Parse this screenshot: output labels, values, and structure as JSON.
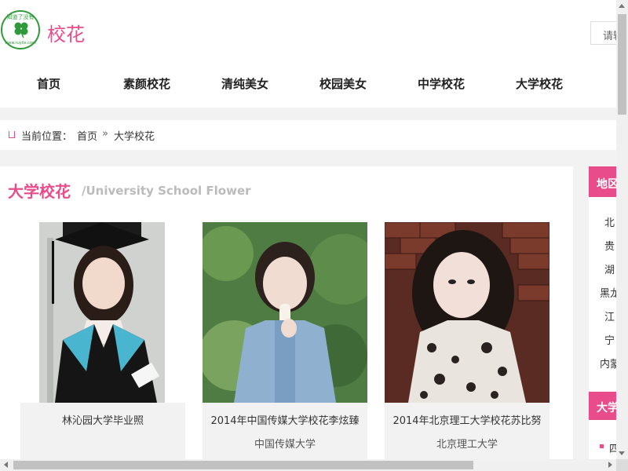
{
  "site": {
    "logo_text": "知道了没有",
    "logo_url": "www.ruyile.com",
    "title": "校花",
    "search_placeholder": "请输入"
  },
  "nav": [
    "首页",
    "素颜校花",
    "清纯美女",
    "校园美女",
    "中学校花",
    "大学校花"
  ],
  "breadcrumb": {
    "label": "当前位置：",
    "home": "首页",
    "separator": "»",
    "current": "大学校花"
  },
  "section": {
    "title": "大学校花",
    "subtitle": "/University School Flower"
  },
  "cards": [
    {
      "name": "林沁园大学毕业照",
      "school": ""
    },
    {
      "name": "2014年中国传媒大学校花李炫臻",
      "school": "中国传媒大学"
    },
    {
      "name": "2014年北京理工大学校花苏比努",
      "school": "北京理工大学"
    }
  ],
  "sidebar": {
    "region_title": "地区",
    "regions": [
      "北",
      "贵",
      "湖",
      "黑龙",
      "江",
      "宁",
      "内蒙"
    ],
    "second_title": "大学",
    "second_item": "四"
  },
  "colors": {
    "accent": "#e84c8b",
    "logo_green": "#2f9a3a"
  }
}
